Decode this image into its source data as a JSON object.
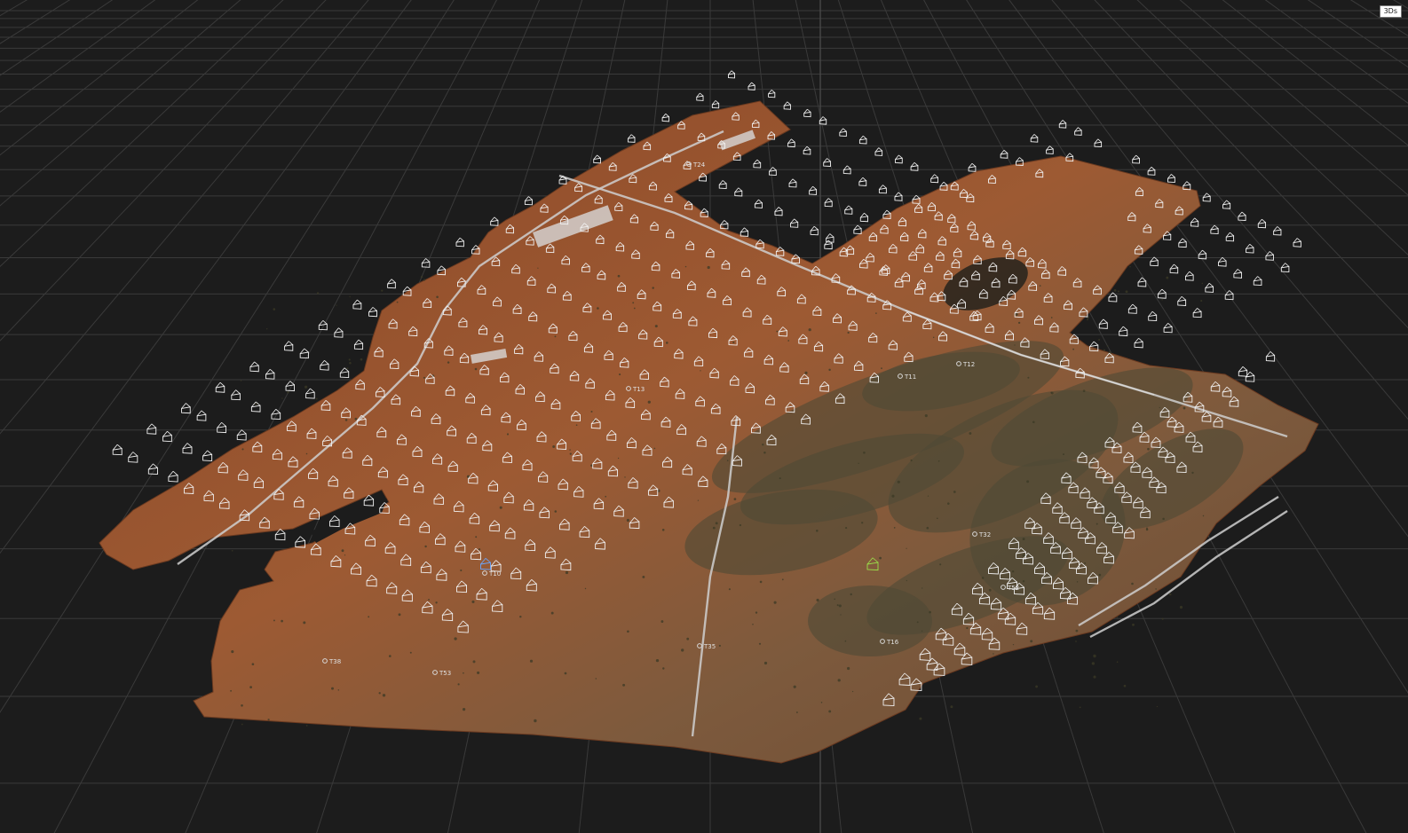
{
  "view_mode_label": "3Ds",
  "scene": {
    "background_color": "#1c1c1c",
    "grid_color": "#3a3a3a",
    "camera_color": "#f2f2f2",
    "highlight_camera_color": "#9be04a",
    "selected_camera_color": "#6aa7ff",
    "terrain_colors": [
      "#8a4a27",
      "#9c5730",
      "#7a5236",
      "#5f5b43"
    ],
    "road_color": "#cfcfcf"
  },
  "markers": [
    {
      "id": "t24",
      "label": "T24"
    },
    {
      "id": "t13",
      "label": "T13"
    },
    {
      "id": "t11",
      "label": "T11"
    },
    {
      "id": "t12",
      "label": "T12"
    },
    {
      "id": "t32",
      "label": "T32"
    },
    {
      "id": "t52",
      "label": "T52"
    },
    {
      "id": "t35",
      "label": "T35"
    },
    {
      "id": "t16",
      "label": "T16"
    },
    {
      "id": "t38",
      "label": "T38"
    },
    {
      "id": "t53",
      "label": "T53"
    },
    {
      "id": "t10",
      "label": "T10"
    }
  ]
}
